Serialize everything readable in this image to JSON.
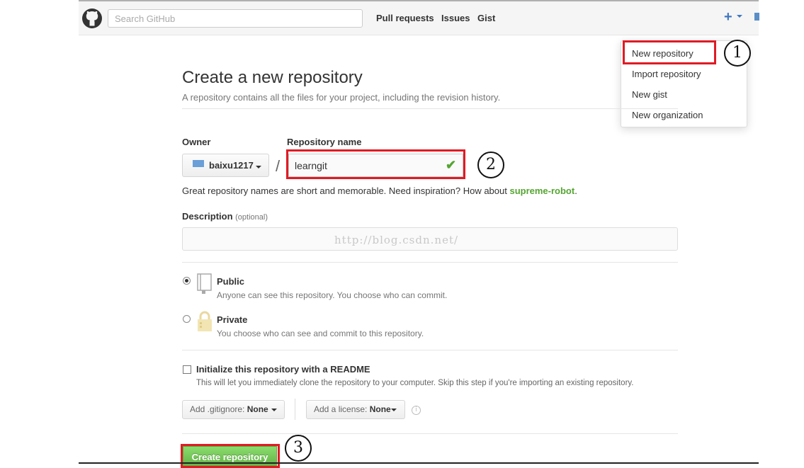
{
  "header": {
    "search_placeholder": "Search GitHub",
    "nav": [
      "Pull requests",
      "Issues",
      "Gist"
    ],
    "plus_icon": "+"
  },
  "dropdown": {
    "items": [
      "New repository",
      "Import repository",
      "New gist",
      "New organization"
    ]
  },
  "page": {
    "title": "Create a new repository",
    "subtitle": "A repository contains all the files for your project, including the revision history."
  },
  "form": {
    "owner_label": "Owner",
    "owner_value": "baixu1217",
    "separator": "/",
    "repo_label": "Repository name",
    "repo_value": "learngit",
    "hint_text": "Great repository names are short and memorable. Need inspiration? How about ",
    "hint_suggestion": "supreme-robot",
    "hint_end": ".",
    "description_label": "Description",
    "description_optional": "(optional)",
    "watermark": "http://blog.csdn.net/",
    "public_title": "Public",
    "public_desc": "Anyone can see this repository. You choose who can commit.",
    "private_title": "Private",
    "private_desc": "You choose who can see and commit to this repository.",
    "readme_title": "Initialize this repository with a README",
    "readme_desc": "This will let you immediately clone the repository to your computer. Skip this step if you're importing an existing repository.",
    "gitignore_prefix": "Add .gitignore:",
    "gitignore_value": "None",
    "license_prefix": "Add a license:",
    "license_value": "None",
    "info_icon": "i",
    "create_button": "Create repository",
    "selected_visibility": "Public",
    "readme_checked": false
  },
  "annotations": [
    "1",
    "2",
    "3"
  ],
  "colors": {
    "accent_blue": "#4078c0",
    "success_green": "#55a532",
    "highlight_red": "#e01b24"
  }
}
